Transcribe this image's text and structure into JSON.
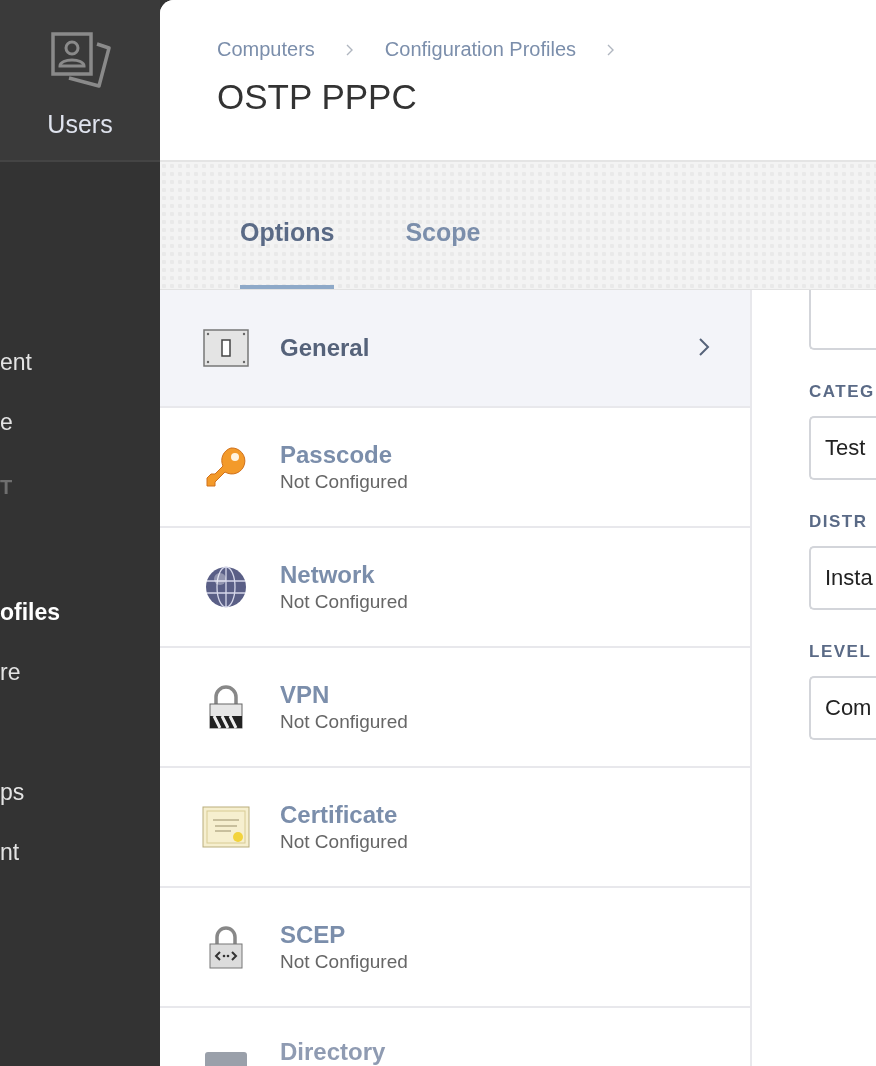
{
  "sidebar": {
    "top_item": {
      "label": "Users"
    },
    "items": [
      {
        "label": "ent",
        "kind": "link",
        "selected": false
      },
      {
        "label": "e",
        "kind": "link",
        "selected": false
      },
      {
        "label": "T",
        "kind": "header",
        "selected": false
      },
      {
        "label": "ofiles",
        "kind": "link",
        "selected": true
      },
      {
        "label": "re",
        "kind": "link",
        "selected": false
      },
      {
        "label": "ps",
        "kind": "link",
        "selected": false
      },
      {
        "label": "nt",
        "kind": "link",
        "selected": false
      }
    ]
  },
  "breadcrumbs": [
    "Computers",
    "Configuration Profiles"
  ],
  "title": "OSTP PPPC",
  "tabs": [
    {
      "label": "Options",
      "selected": true
    },
    {
      "label": "Scope",
      "selected": false
    }
  ],
  "payloads": [
    {
      "name": "General",
      "selected": true
    },
    {
      "name": "Passcode",
      "status": "Not Configured",
      "selected": false
    },
    {
      "name": "Network",
      "status": "Not Configured",
      "selected": false
    },
    {
      "name": "VPN",
      "status": "Not Configured",
      "selected": false
    },
    {
      "name": "Certificate",
      "status": "Not Configured",
      "selected": false
    },
    {
      "name": "SCEP",
      "status": "Not Configured",
      "selected": false
    },
    {
      "name": "Directory",
      "selected": false,
      "faded": true
    }
  ],
  "form": [
    {
      "label": "CATEG",
      "value": "Test"
    },
    {
      "label": "DISTR",
      "value": "Insta"
    },
    {
      "label": "LEVEL",
      "value": "Com"
    }
  ]
}
